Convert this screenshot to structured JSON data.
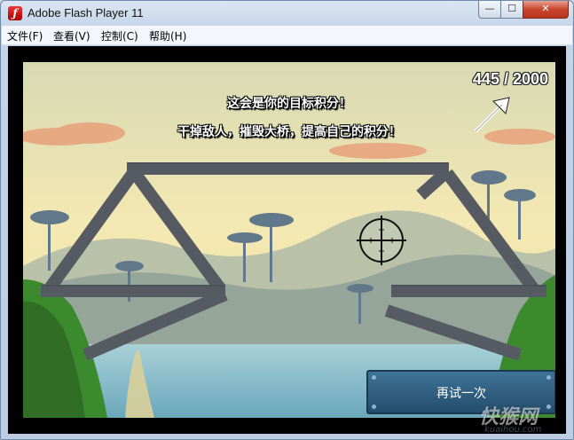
{
  "window": {
    "title": "Adobe Flash Player 11",
    "app_icon": "flash-icon",
    "controls": {
      "minimize": "—",
      "maximize": "☐",
      "close": "✕"
    }
  },
  "menu": [
    "文件(F)",
    "查看(V)",
    "控制(C)",
    "帮助(H)"
  ],
  "game": {
    "score": "445 / 2000",
    "message_line1": "这会是你的目标积分！",
    "message_line2": "干掉敌人，摧毁大桥，提高自己的积分！",
    "retry_label": "再试一次",
    "crosshair": "crosshair-icon",
    "arrow": "arrow-up-right-icon"
  },
  "watermark": {
    "main": "快猴网",
    "sub": "kuaihou.com"
  },
  "colors": {
    "sky_top": "#f3e7b0",
    "water": "#7fb7c8",
    "grass": "#3c8a2e",
    "bridge": "#5b5f66",
    "retry_button": "#2f5f82"
  }
}
